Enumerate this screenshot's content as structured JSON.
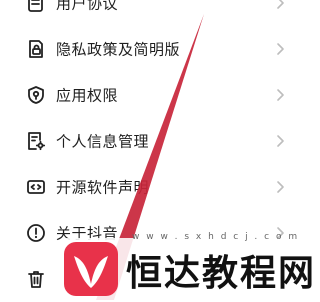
{
  "settings": {
    "items": [
      {
        "label": "用户协议",
        "icon": "document-icon"
      },
      {
        "label": "隐私政策及简明版",
        "icon": "lock-document-icon"
      },
      {
        "label": "应用权限",
        "icon": "shield-icon"
      },
      {
        "label": "个人信息管理",
        "icon": "gear-document-icon"
      },
      {
        "label": "开源软件声明",
        "icon": "code-icon"
      },
      {
        "label": "关于抖音",
        "icon": "info-icon"
      },
      {
        "label": "",
        "icon": "trash-icon"
      }
    ]
  },
  "watermark": {
    "brand": "恒达教程网",
    "url": "w w w . s x h d c j . c o m"
  },
  "colors": {
    "accent_red": "#c8253a",
    "chevron": "#bdbdbd",
    "text": "#1f1f1f"
  }
}
